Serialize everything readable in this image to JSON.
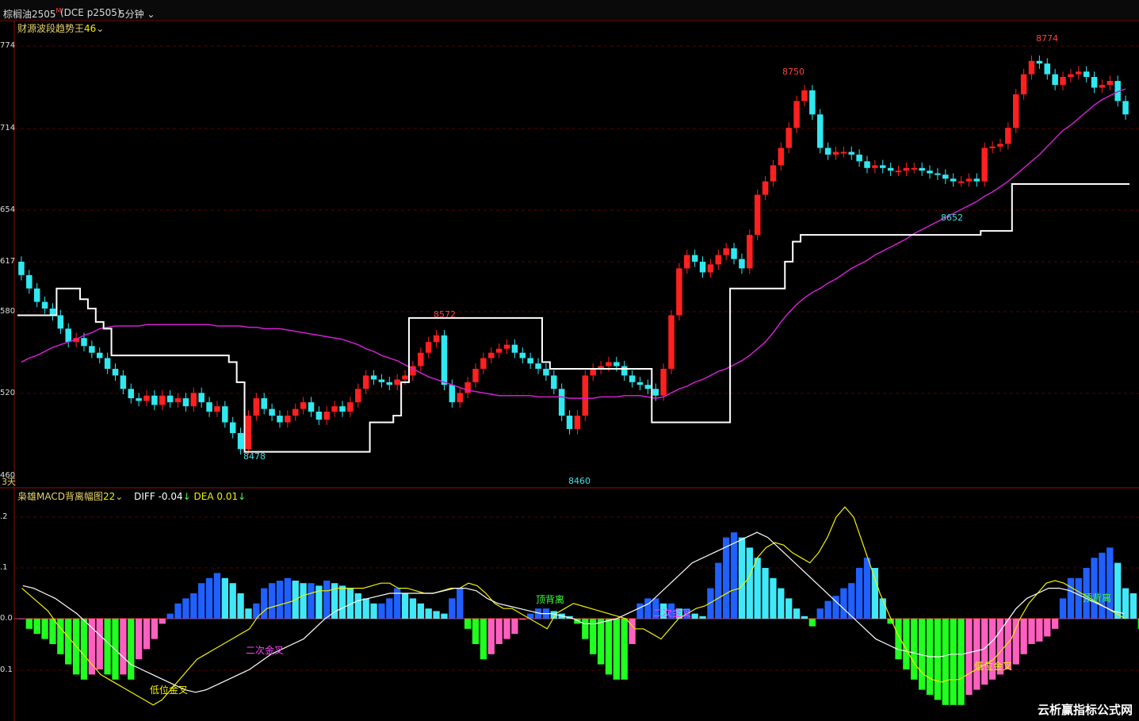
{
  "header": {
    "symbol": "棕榈油2505",
    "symbol_sup": "M",
    "exchange": "(DCE p2505)",
    "period": "5分钟"
  },
  "main_indicator": {
    "name": "财源波段趋势王",
    "param": "46"
  },
  "period_note": "3天",
  "y_axis_labels": [
    "774",
    "714",
    "654",
    "617",
    "580",
    "520",
    "460"
  ],
  "macd_indicator": {
    "name": "枭雄MACD背离幅图",
    "param": "22",
    "diff_label": "DIFF",
    "diff_value": "-0.04",
    "dea_label": "DEA",
    "dea_value": "0.01"
  },
  "macd_y_labels": [
    ".2",
    ".1",
    "0.0",
    "0.1"
  ],
  "price_annotations": [
    {
      "text": "8750",
      "color": "#ff4040"
    },
    {
      "text": "8774",
      "color": "#ff4040"
    },
    {
      "text": "8572",
      "color": "#ff4040"
    },
    {
      "text": "8478",
      "color": "#40e0e0"
    },
    {
      "text": "8460",
      "color": "#40e0e0"
    },
    {
      "text": "8652",
      "color": "#40e0e0"
    }
  ],
  "macd_annotations": [
    {
      "text": "低位金叉",
      "color": "#f0f000"
    },
    {
      "text": "二次金叉",
      "color": "#ff40ff"
    },
    {
      "text": "顶背离",
      "color": "#40ff40"
    },
    {
      "text": "二次金叉",
      "color": "#ff40ff"
    },
    {
      "text": "低位金叉",
      "color": "#f0f000"
    },
    {
      "text": "顶背离",
      "color": "#40ff40"
    }
  ],
  "watermark": "云析赢指标公式网",
  "colors": {
    "up": "#ff2020",
    "down": "#30e8f0",
    "ma": "#d020d0",
    "band": "#ffffff",
    "grid": "#5a0000"
  },
  "chart_data": {
    "type": "candlestick",
    "ylim": [
      8460,
      8774
    ],
    "close": [
      8610,
      8600,
      8590,
      8585,
      8580,
      8570,
      8560,
      8563,
      8557,
      8552,
      8548,
      8540,
      8535,
      8525,
      8518,
      8516,
      8520,
      8513,
      8520,
      8515,
      8518,
      8512,
      8522,
      8515,
      8508,
      8512,
      8500,
      8492,
      8480,
      8505,
      8518,
      8510,
      8505,
      8500,
      8505,
      8510,
      8515,
      8508,
      8502,
      8508,
      8512,
      8508,
      8515,
      8525,
      8535,
      8532,
      8530,
      8528,
      8532,
      8535,
      8542,
      8552,
      8560,
      8565,
      8528,
      8515,
      8522,
      8530,
      8540,
      8548,
      8552,
      8555,
      8558,
      8552,
      8548,
      8544,
      8540,
      8535,
      8525,
      8505,
      8495,
      8505,
      8535,
      8540,
      8542,
      8545,
      8542,
      8535,
      8530,
      8528,
      8525,
      8520,
      8540,
      8580,
      8615,
      8625,
      8620,
      8612,
      8618,
      8625,
      8630,
      8622,
      8615,
      8640,
      8670,
      8680,
      8692,
      8705,
      8720,
      8740,
      8748,
      8730,
      8705,
      8700,
      8702,
      8702,
      8700,
      8695,
      8690,
      8692,
      8690,
      8688,
      8688,
      8690,
      8690,
      8688,
      8686,
      8685,
      8682,
      8680,
      8680,
      8682,
      8680,
      8705,
      8706,
      8708,
      8720,
      8745,
      8760,
      8770,
      8768,
      8760,
      8752,
      8758,
      8760,
      8762,
      8758,
      8750,
      8752,
      8755,
      8740,
      8730
    ],
    "band": [
      8580,
      8580,
      8580,
      8580,
      8580,
      8600,
      8600,
      8600,
      8592,
      8585,
      8575,
      8570,
      8550,
      8550,
      8550,
      8550,
      8550,
      8550,
      8550,
      8550,
      8550,
      8550,
      8550,
      8550,
      8550,
      8550,
      8550,
      8545,
      8530,
      8478,
      8478,
      8478,
      8478,
      8478,
      8478,
      8478,
      8478,
      8478,
      8478,
      8478,
      8478,
      8478,
      8478,
      8478,
      8478,
      8500,
      8500,
      8500,
      8505,
      8530,
      8578,
      8578,
      8578,
      8578,
      8578,
      8578,
      8578,
      8578,
      8578,
      8578,
      8578,
      8578,
      8578,
      8578,
      8578,
      8578,
      8578,
      8545,
      8540,
      8540,
      8540,
      8540,
      8540,
      8540,
      8540,
      8540,
      8540,
      8540,
      8540,
      8540,
      8540,
      8500,
      8500,
      8500,
      8500,
      8500,
      8500,
      8500,
      8500,
      8500,
      8500,
      8600,
      8600,
      8600,
      8600,
      8600,
      8600,
      8600,
      8620,
      8635,
      8640,
      8640,
      8640,
      8640,
      8640,
      8640,
      8640,
      8640,
      8640,
      8640,
      8640,
      8640,
      8640,
      8640,
      8640,
      8640,
      8640,
      8640,
      8640,
      8640,
      8640,
      8640,
      8640,
      8643,
      8643,
      8643,
      8643,
      8678,
      8678,
      8678,
      8678,
      8678,
      8678,
      8678,
      8678,
      8678,
      8678,
      8678,
      8678,
      8678,
      8678,
      8678
    ],
    "ma": [
      8545,
      8548,
      8550,
      8553,
      8556,
      8558,
      8560,
      8562,
      8565,
      8567,
      8570,
      8571,
      8572,
      8572,
      8572,
      8572,
      8573,
      8573,
      8573,
      8573,
      8573,
      8573,
      8573,
      8573,
      8573,
      8572,
      8572,
      8572,
      8572,
      8571,
      8571,
      8570,
      8570,
      8570,
      8569,
      8568,
      8567,
      8566,
      8565,
      8564,
      8563,
      8562,
      8560,
      8558,
      8555,
      8553,
      8550,
      8548,
      8546,
      8543,
      8540,
      8537,
      8534,
      8532,
      8530,
      8528,
      8526,
      8524,
      8523,
      8522,
      8521,
      8520,
      8520,
      8520,
      8520,
      8520,
      8519,
      8519,
      8519,
      8519,
      8518,
      8518,
      8518,
      8518,
      8519,
      8519,
      8519,
      8520,
      8520,
      8520,
      8519,
      8518,
      8519,
      8522,
      8525,
      8527,
      8530,
      8532,
      8535,
      8538,
      8540,
      8543,
      8546,
      8550,
      8555,
      8560,
      8567,
      8575,
      8582,
      8588,
      8593,
      8597,
      8600,
      8604,
      8607,
      8611,
      8615,
      8618,
      8621,
      8625,
      8628,
      8631,
      8634,
      8637,
      8641,
      8644,
      8647,
      8650,
      8653,
      8656,
      8659,
      8662,
      8665,
      8669,
      8672,
      8676,
      8680,
      8685,
      8690,
      8695,
      8700,
      8706,
      8712,
      8718,
      8722,
      8727,
      8732,
      8737,
      8741,
      8744,
      8747,
      8749
    ],
    "macd_hist": [
      0,
      -0.02,
      -0.03,
      -0.04,
      -0.05,
      -0.07,
      -0.09,
      -0.11,
      -0.12,
      -0.11,
      -0.1,
      -0.11,
      -0.12,
      -0.11,
      -0.12,
      -0.08,
      -0.06,
      -0.04,
      -0.01,
      0.01,
      0.03,
      0.04,
      0.05,
      0.07,
      0.08,
      0.09,
      0.08,
      0.07,
      0.05,
      0.02,
      0.03,
      0.06,
      0.07,
      0.075,
      0.08,
      0.075,
      0.07,
      0.07,
      0.065,
      0.075,
      0.07,
      0.065,
      0.06,
      0.05,
      0.04,
      0.03,
      0.03,
      0.04,
      0.06,
      0.05,
      0.04,
      0.03,
      0.02,
      0.015,
      0.01,
      0.04,
      0.06,
      -0.02,
      -0.05,
      -0.08,
      -0.07,
      -0.05,
      -0.04,
      -0.03,
      -0.002,
      0.01,
      0.02,
      0.02,
      0.015,
      0.01,
      0.005,
      -0.01,
      -0.04,
      -0.07,
      -0.09,
      -0.11,
      -0.12,
      -0.12,
      -0.05,
      0.03,
      0.04,
      0.04,
      0.03,
      0.03,
      0.02,
      0.02,
      0.01,
      0.005,
      0.06,
      0.11,
      0.16,
      0.17,
      0.16,
      0.14,
      0.12,
      0.1,
      0.08,
      0.06,
      0.04,
      0.02,
      0.005,
      -0.015,
      0.02,
      0.035,
      0.045,
      0.06,
      0.07,
      0.1,
      0.12,
      0.1,
      0.04,
      -0.01,
      -0.08,
      -0.1,
      -0.12,
      -0.14,
      -0.15,
      -0.16,
      -0.17,
      -0.17,
      -0.17,
      -0.15,
      -0.14,
      -0.13,
      -0.12,
      -0.11,
      -0.1,
      -0.09,
      -0.07,
      -0.05,
      -0.045,
      -0.035,
      -0.02,
      0.04,
      0.08,
      0.08,
      0.1,
      0.12,
      0.13,
      0.14,
      0.11,
      0.06,
      0.05,
      -0.02,
      -0.05,
      -0.09
    ],
    "diff": [
      0.06,
      0.045,
      0.03,
      0.015,
      -0.01,
      -0.03,
      -0.05,
      -0.07,
      -0.09,
      -0.11,
      -0.12,
      -0.13,
      -0.14,
      -0.15,
      -0.16,
      -0.17,
      -0.16,
      -0.14,
      -0.12,
      -0.1,
      -0.08,
      -0.07,
      -0.06,
      -0.05,
      -0.04,
      -0.03,
      -0.02,
      0.005,
      0.02,
      0.025,
      0.03,
      0.035,
      0.045,
      0.05,
      0.055,
      0.055,
      0.06,
      0.06,
      0.06,
      0.06,
      0.065,
      0.07,
      0.07,
      0.06,
      0.06,
      0.055,
      0.05,
      0.05,
      0.055,
      0.06,
      0.06,
      0.07,
      0.065,
      0.05,
      0.03,
      0.02,
      0.02,
      0.01,
      0.0,
      -0.01,
      -0.02,
      0.01,
      0.02,
      0.03,
      0.025,
      0.02,
      0.015,
      0.01,
      0.005,
      0.0,
      -0.02,
      -0.02,
      -0.03,
      -0.04,
      -0.02,
      0.0,
      0.01,
      0.02,
      0.025,
      0.035,
      0.045,
      0.055,
      0.06,
      0.08,
      0.12,
      0.14,
      0.15,
      0.145,
      0.13,
      0.12,
      0.11,
      0.13,
      0.16,
      0.2,
      0.22,
      0.2,
      0.15,
      0.1,
      0.05,
      0.01,
      -0.03,
      -0.06,
      -0.09,
      -0.11,
      -0.12,
      -0.125,
      -0.12,
      -0.12,
      -0.11,
      -0.1,
      -0.09,
      -0.08,
      -0.06,
      -0.04,
      0.0,
      0.03,
      0.05,
      0.07,
      0.075,
      0.07,
      0.06,
      0.05,
      0.04,
      0.03,
      0.02,
      0.01,
      0.0
    ],
    "dea": [
      0.065,
      0.06,
      0.05,
      0.04,
      0.025,
      0.01,
      -0.01,
      -0.03,
      -0.05,
      -0.07,
      -0.09,
      -0.1,
      -0.11,
      -0.12,
      -0.13,
      -0.14,
      -0.145,
      -0.14,
      -0.13,
      -0.12,
      -0.11,
      -0.1,
      -0.085,
      -0.07,
      -0.06,
      -0.05,
      -0.04,
      -0.02,
      0.0,
      0.015,
      0.025,
      0.035,
      0.04,
      0.045,
      0.05,
      0.05,
      0.05,
      0.05,
      0.05,
      0.055,
      0.06,
      0.06,
      0.055,
      0.04,
      0.03,
      0.025,
      0.02,
      0.015,
      0.01,
      0.01,
      0.005,
      0.0,
      -0.01,
      -0.01,
      -0.005,
      0.0,
      0.01,
      0.02,
      0.03,
      0.05,
      0.07,
      0.09,
      0.11,
      0.12,
      0.13,
      0.14,
      0.15,
      0.16,
      0.17,
      0.16,
      0.14,
      0.12,
      0.1,
      0.08,
      0.06,
      0.04,
      0.02,
      0.0,
      -0.02,
      -0.04,
      -0.05,
      -0.06,
      -0.065,
      -0.07,
      -0.075,
      -0.075,
      -0.07,
      -0.07,
      -0.065,
      -0.06,
      -0.04,
      -0.01,
      0.02,
      0.04,
      0.05,
      0.06,
      0.06,
      0.055,
      0.045,
      0.035,
      0.025,
      0.015,
      0.01
    ]
  }
}
